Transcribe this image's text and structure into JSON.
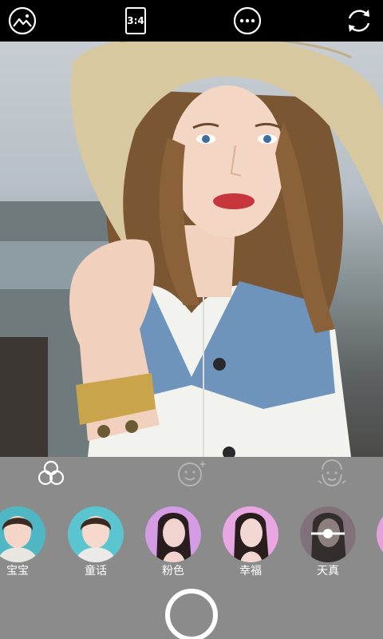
{
  "toolbar": {
    "gallery_icon": "image-landscape-icon",
    "aspect_ratio": "3:4",
    "more_icon": "more-dots-icon",
    "switch_camera_icon": "camera-switch-icon"
  },
  "tabs": [
    {
      "name": "filters",
      "icon": "three-circles-icon",
      "active": true
    },
    {
      "name": "beauty",
      "icon": "smiley-sparkle-icon",
      "active": false
    },
    {
      "name": "face-shape",
      "icon": "face-outline-icon",
      "active": false
    }
  ],
  "filters": {
    "items": [
      {
        "label": "宝宝",
        "tint": "#4fb6c4",
        "selected": false
      },
      {
        "label": "童话",
        "tint": "#5ac4cf",
        "selected": false
      },
      {
        "label": "粉色",
        "tint": "#d59ce6",
        "selected": false
      },
      {
        "label": "幸福",
        "tint": "#e8a7e3",
        "selected": false
      },
      {
        "label": "天真",
        "tint": "#5a5252",
        "selected": true
      }
    ]
  },
  "shutter": {
    "icon": "shutter-button"
  },
  "colors": {
    "toolbar_bg": "#000000",
    "panel_bg": "#8b8b8b",
    "foreground": "#ffffff"
  }
}
